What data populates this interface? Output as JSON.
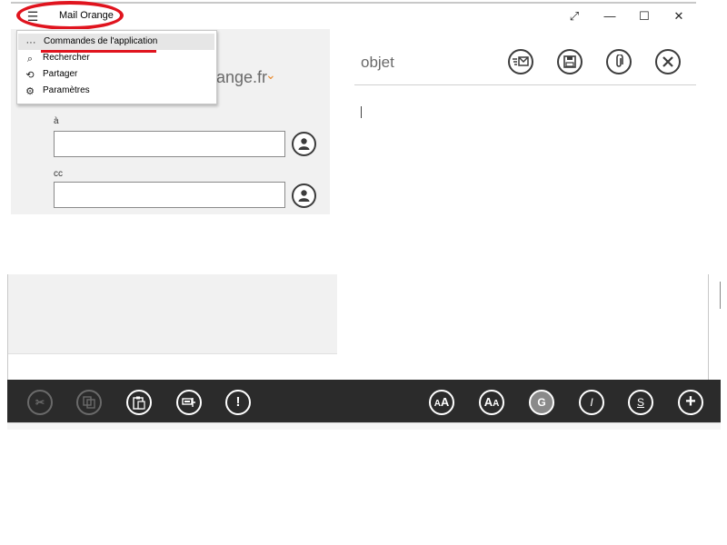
{
  "window": {
    "title": "Mail Orange",
    "controls": [
      "resize-icon",
      "minimize-icon",
      "maximize-icon",
      "close-icon"
    ]
  },
  "menu": {
    "items": [
      {
        "label": "Commandes de l'application",
        "icon": "more-icon"
      },
      {
        "label": "Rechercher",
        "icon": "search-icon"
      },
      {
        "label": "Partager",
        "icon": "share-icon"
      },
      {
        "label": "Paramètres",
        "icon": "gear-icon"
      }
    ]
  },
  "sender": {
    "domain_fragment": "range.fr"
  },
  "recipients": {
    "to_label": "à",
    "to_value": "",
    "cc_label": "cc",
    "cc_value": ""
  },
  "compose": {
    "subject_placeholder": "objet",
    "toolbar_icons": [
      "send-icon",
      "save-icon",
      "attach-icon",
      "discard-icon"
    ]
  },
  "appbar": {
    "left_icons": [
      "cut-icon",
      "copy-icon",
      "paste-icon",
      "paste-format-icon",
      "priority-icon"
    ],
    "right_icons": [
      "font-size-up-icon",
      "font-size-down-icon",
      "bold-icon",
      "italic-icon",
      "underline-icon",
      "more-add-icon"
    ],
    "bold_label": "G",
    "italic_label": "I",
    "underline_label": "S"
  },
  "colors": {
    "highlight_red": "#e0141e",
    "accent_orange": "#e98a2d",
    "appbar_bg": "#2b2b2b"
  }
}
